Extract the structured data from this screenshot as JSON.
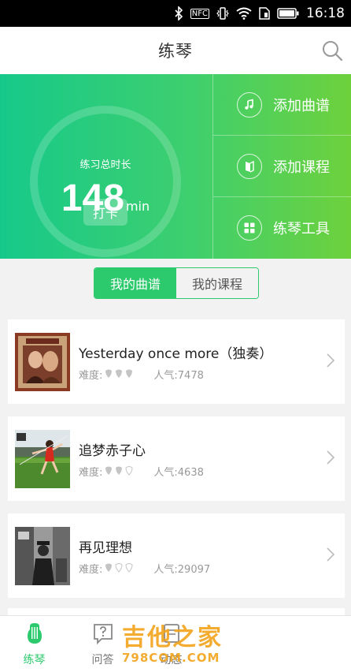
{
  "status_bar": {
    "time": "16:18",
    "nfc": "NFC"
  },
  "header": {
    "title": "练琴"
  },
  "practice": {
    "label": "练习总时长",
    "minutes": "148",
    "unit": "min",
    "checkin_label": "打卡"
  },
  "quick_menu": [
    {
      "label": "添加曲谱",
      "icon": "music-note-icon"
    },
    {
      "label": "添加课程",
      "icon": "book-icon"
    },
    {
      "label": "练琴工具",
      "icon": "grid-icon"
    }
  ],
  "segment": {
    "tabs": [
      "我的曲谱",
      "我的课程"
    ],
    "selected": "我的曲谱"
  },
  "songs": [
    {
      "title": "Yesterday once more（独奏）",
      "difficulty_label": "难度:",
      "difficulty": 3,
      "popularity": "人气:7478"
    },
    {
      "title": "追梦赤子心",
      "difficulty_label": "难度:",
      "difficulty": 2,
      "popularity": "人气:4638"
    },
    {
      "title": "再见理想",
      "difficulty_label": "难度:",
      "difficulty": 1,
      "popularity": "人气:29097"
    }
  ],
  "tabbar": [
    {
      "label": "练琴",
      "active": true
    },
    {
      "label": "问答",
      "active": false
    },
    {
      "label": "动态",
      "active": false
    }
  ],
  "watermark": {
    "text_cn": "吉他之家",
    "text_en": "798COM.COM"
  },
  "colors": {
    "accent": "#2dc96d",
    "hero_start": "#16c98a",
    "hero_end": "#6ed13c",
    "watermark": "#f2a21a"
  }
}
